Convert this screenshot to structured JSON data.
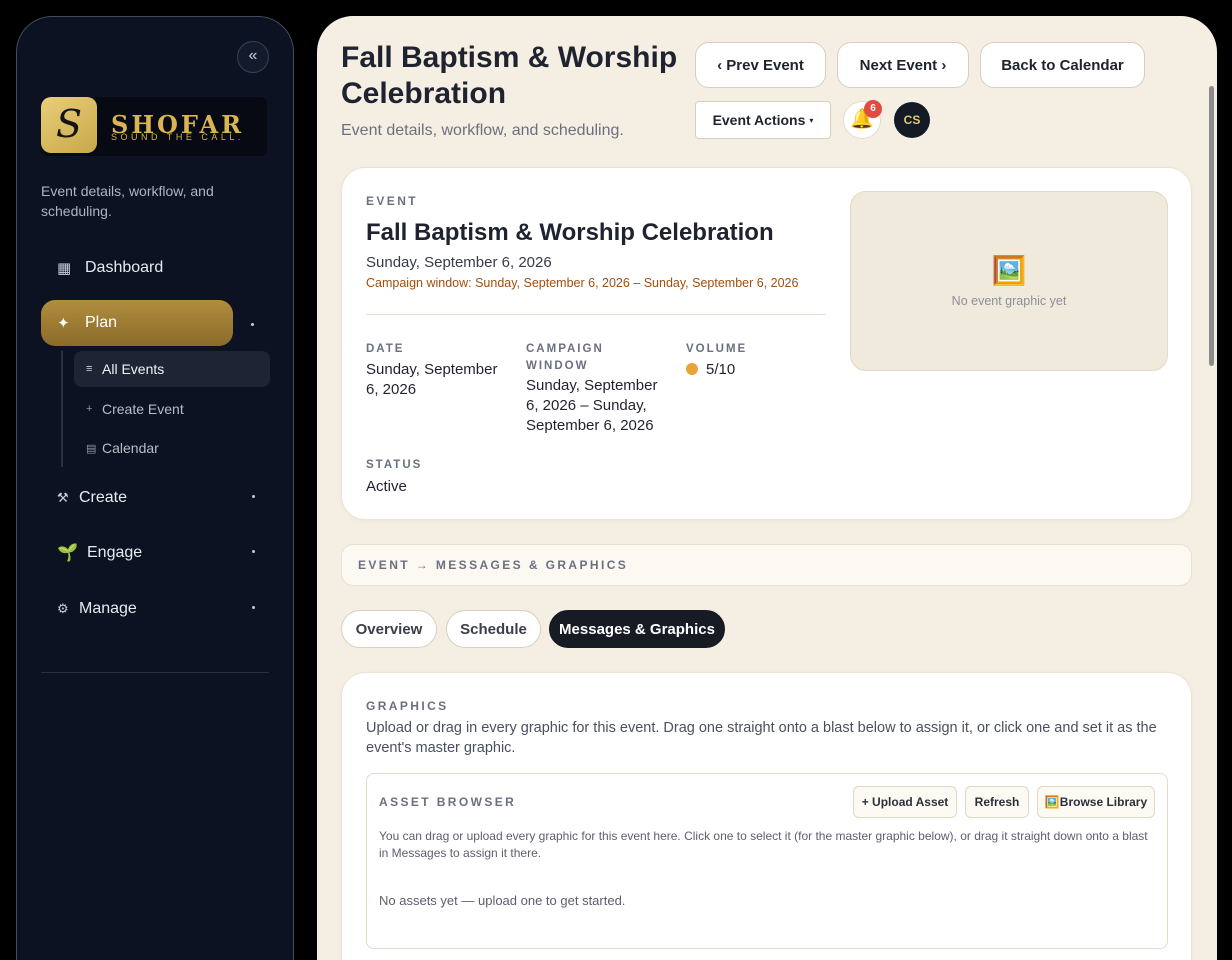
{
  "sidebar": {
    "collapse_icon": "«",
    "logo": {
      "mark": "S",
      "name": "SHOFAR",
      "tagline": "SOUND THE CALL."
    },
    "description": "Event details, workflow, and scheduling.",
    "nav": [
      {
        "label": "Dashboard",
        "icon": "grid-icon",
        "glyph": "▦"
      },
      {
        "label": "Plan",
        "icon": "sparkle-icon",
        "glyph": "✦"
      },
      {
        "label": "Create",
        "icon": "hammer-icon",
        "glyph": "⚒"
      },
      {
        "label": "Engage",
        "icon": "sprout-icon",
        "glyph": "🌱"
      },
      {
        "label": "Manage",
        "icon": "gear-icon",
        "glyph": "⚙"
      }
    ],
    "subnav": [
      {
        "label": "All Events",
        "icon": "list-icon",
        "glyph": "≡"
      },
      {
        "label": "Create Event",
        "icon": "plus-icon",
        "glyph": "+"
      },
      {
        "label": "Calendar",
        "icon": "calendar-icon",
        "glyph": "▤"
      }
    ]
  },
  "header": {
    "title": "Fall Baptism & Worship Celebration",
    "subtitle": "Event details, workflow, and scheduling.",
    "prev_label": "‹ Prev Event",
    "next_label": "Next Event ›",
    "back_label": "Back to Calendar",
    "actions_label": "Event Actions",
    "actions_caret": "▾",
    "bell_glyph": "🔔",
    "notification_count": "6",
    "avatar_initials": "CS"
  },
  "event": {
    "eyebrow": "EVENT",
    "title": "Fall Baptism & Worship Celebration",
    "date": "Sunday, September 6, 2026",
    "campaign": "Campaign window: Sunday, September 6, 2026 – Sunday, September 6, 2026",
    "fields": {
      "date_label": "DATE",
      "date_value": "Sunday, September 6, 2026",
      "campaign_label": "CAMPAIGN WINDOW",
      "campaign_value": "Sunday, September 6, 2026 – Sunday, September 6, 2026",
      "volume_label": "VOLUME",
      "volume_value": "5/10",
      "status_label": "STATUS",
      "status_value": "Active"
    },
    "graphic_glyph": "🖼️",
    "graphic_empty": "No event graphic yet"
  },
  "breadcrumb": "EVENT → MESSAGES & GRAPHICS",
  "tabs": [
    {
      "label": "Overview"
    },
    {
      "label": "Schedule"
    },
    {
      "label": "Messages & Graphics"
    }
  ],
  "graphics": {
    "eyebrow": "GRAPHICS",
    "description": "Upload or drag in every graphic for this event. Drag one straight onto a blast below to assign it, or click one and set it as the event's master graphic.",
    "asset_browser": {
      "title": "ASSET BROWSER",
      "upload_label": "+ Upload Asset",
      "refresh_label": "Refresh",
      "library_label": "🖼️Browse Library",
      "help": "You can drag or upload every graphic for this event here. Click one to select it (for the master graphic below), or drag it straight down onto a blast in Messages to assign it there.",
      "empty": "No assets yet — upload one to get started."
    }
  },
  "colors": {
    "sidebar_bg": "#0c1222",
    "main_bg": "#f5efe3",
    "accent_gold": "#b18d3d",
    "campaign_text": "#a04f10",
    "volume_dot": "#e8a33a",
    "badge_red": "#e34b3f"
  }
}
